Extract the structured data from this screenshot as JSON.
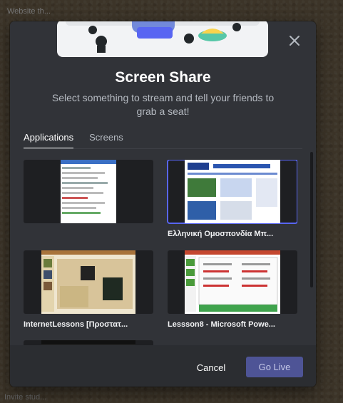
{
  "background": {
    "top_text": "Website th...",
    "bottom_text": "Invite stud..."
  },
  "modal": {
    "title": "Screen Share",
    "subtitle": "Select something to stream and tell your friends to grab a seat!",
    "tabs": [
      {
        "label": "Applications",
        "active": true
      },
      {
        "label": "Screens",
        "active": false
      }
    ],
    "sources": [
      {
        "label": "",
        "selected": false
      },
      {
        "label": "Ελληνική Ομοσπονδία Μπ...",
        "selected": true
      },
      {
        "label": "InternetLessons [Προστατ...",
        "selected": false
      },
      {
        "label": "Lessson8 - Microsoft Powe...",
        "selected": false
      },
      {
        "label": "",
        "selected": false
      }
    ],
    "buttons": {
      "cancel": "Cancel",
      "go_live": "Go Live"
    }
  },
  "colors": {
    "accent": "#5865f2",
    "modal_bg": "#313338",
    "go_live_bg": "#4e5496"
  },
  "icons": {
    "close": "close-icon",
    "hero": "discord-mascot-couch-icon"
  }
}
